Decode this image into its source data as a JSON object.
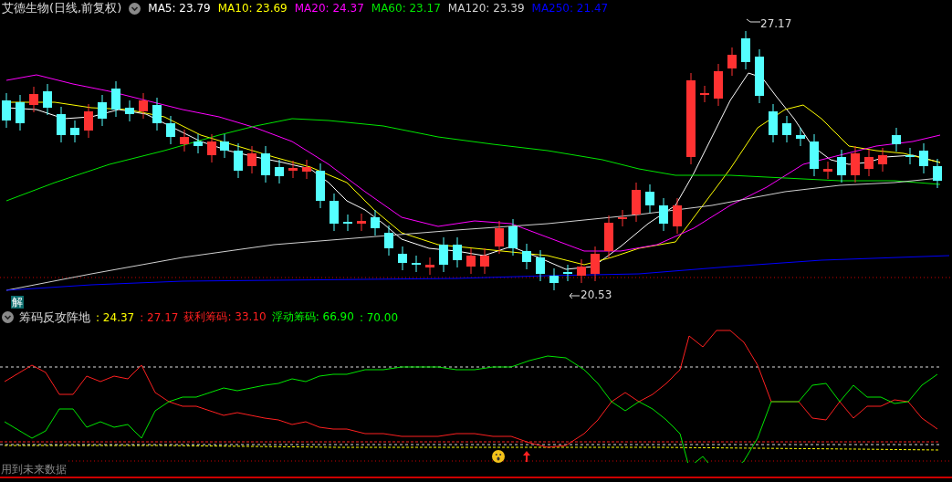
{
  "header": {
    "title": "艾德生物(日线,前复权)",
    "indicators": [
      {
        "label": "MA5: 23.79",
        "color": "#ffffff"
      },
      {
        "label": "MA10: 23.69",
        "color": "#ffff00"
      },
      {
        "label": "MA20: 24.37",
        "color": "#ff00ff"
      },
      {
        "label": "MA60: 23.17",
        "color": "#00e600"
      },
      {
        "label": "MA120: 23.39",
        "color": "#d0d0d0"
      },
      {
        "label": "MA250: 21.47",
        "color": "#0000ff"
      }
    ]
  },
  "main_chart": {
    "high_label": "27.17",
    "low_label": "20.53",
    "badge": "解"
  },
  "sub_chart": {
    "title": "筹码反攻阵地",
    "values": [
      {
        "text": ": 24.37",
        "color": "#ffff00"
      },
      {
        "text": ": 27.17",
        "color": "#ff2020"
      },
      {
        "text": "获利筹码: 33.10",
        "color": "#ff2020"
      },
      {
        "text": "浮动筹码: 66.90",
        "color": "#00ff00"
      },
      {
        "text": ": 70.00",
        "color": "#00ff00"
      }
    ],
    "warning": "用到未来数据"
  }
}
